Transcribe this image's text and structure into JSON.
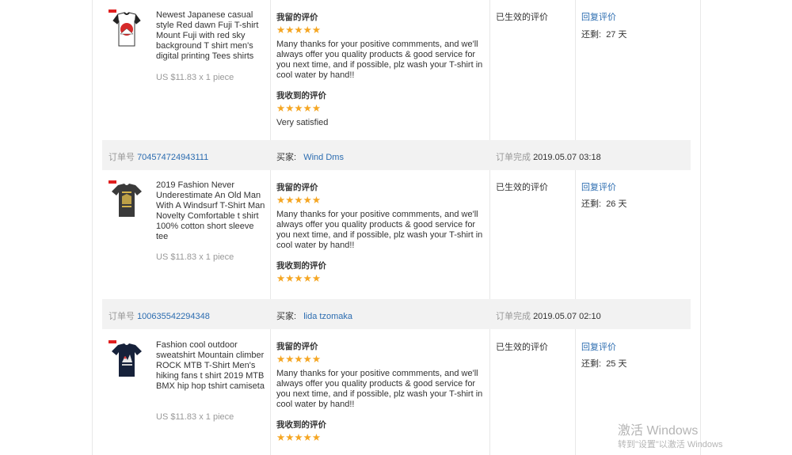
{
  "labels": {
    "order_no": "订单号",
    "buyer": "买家:",
    "order_done": "订单完成",
    "my_review": "我留的评价",
    "received_review": "我收到的评价",
    "status": "已生效的评价",
    "reply": "回复评价",
    "remaining_prefix": "还剩:",
    "stars": "★★★★★"
  },
  "orders": [
    {
      "product_title": "Newest Japanese casual style Red dawn Fuji T-shirt Mount Fuji with red sky background T shirt men's digital printing Tees shirts",
      "price": "US $11.83 x 1 piece",
      "my_review_text": "Many thanks for your positive commments, and we'll always offer you quality products & good service for you next time, and if possible, plz wash your T-shirt in cool water by hand!!",
      "received_review_text": "Very satisfied",
      "remaining": "27 天"
    },
    {
      "order_number": "704574724943111",
      "buyer_name": "Wind Dms",
      "completed_at": "2019.05.07 03:18",
      "product_title": "2019 Fashion Never Underestimate An Old Man With A Windsurf T-Shirt Man Novelty Comfortable t shirt 100% cotton short sleeve tee",
      "price": "US $11.83 x 1 piece",
      "my_review_text": "Many thanks for your positive commments, and we'll always offer you quality products & good service for you next time, and if possible, plz wash your T-shirt in cool water by hand!!",
      "remaining": "26 天"
    },
    {
      "order_number": "100635542294348",
      "buyer_name": "lida tzomaka",
      "completed_at": "2019.05.07 02:10",
      "product_title": "Fashion cool outdoor sweatshirt Mountain climber ROCK MTB T-Shirt Men's hiking fans t shirt 2019 MTB BMX hip hop tshirt camiseta",
      "price": "US $11.83 x 1 piece",
      "my_review_text": "Many thanks for your positive commments, and we'll always offer you quality products & good service for you next time, and if possible, plz wash your T-shirt in cool water by hand!!",
      "remaining": "25 天"
    }
  ],
  "watermark": {
    "line1": "激活 Windows",
    "line2": "转到\"设置\"以激活 Windows"
  },
  "colors": {
    "link": "#2b6cb0",
    "star": "#f5a623",
    "header_bg": "#f2f2f2"
  }
}
